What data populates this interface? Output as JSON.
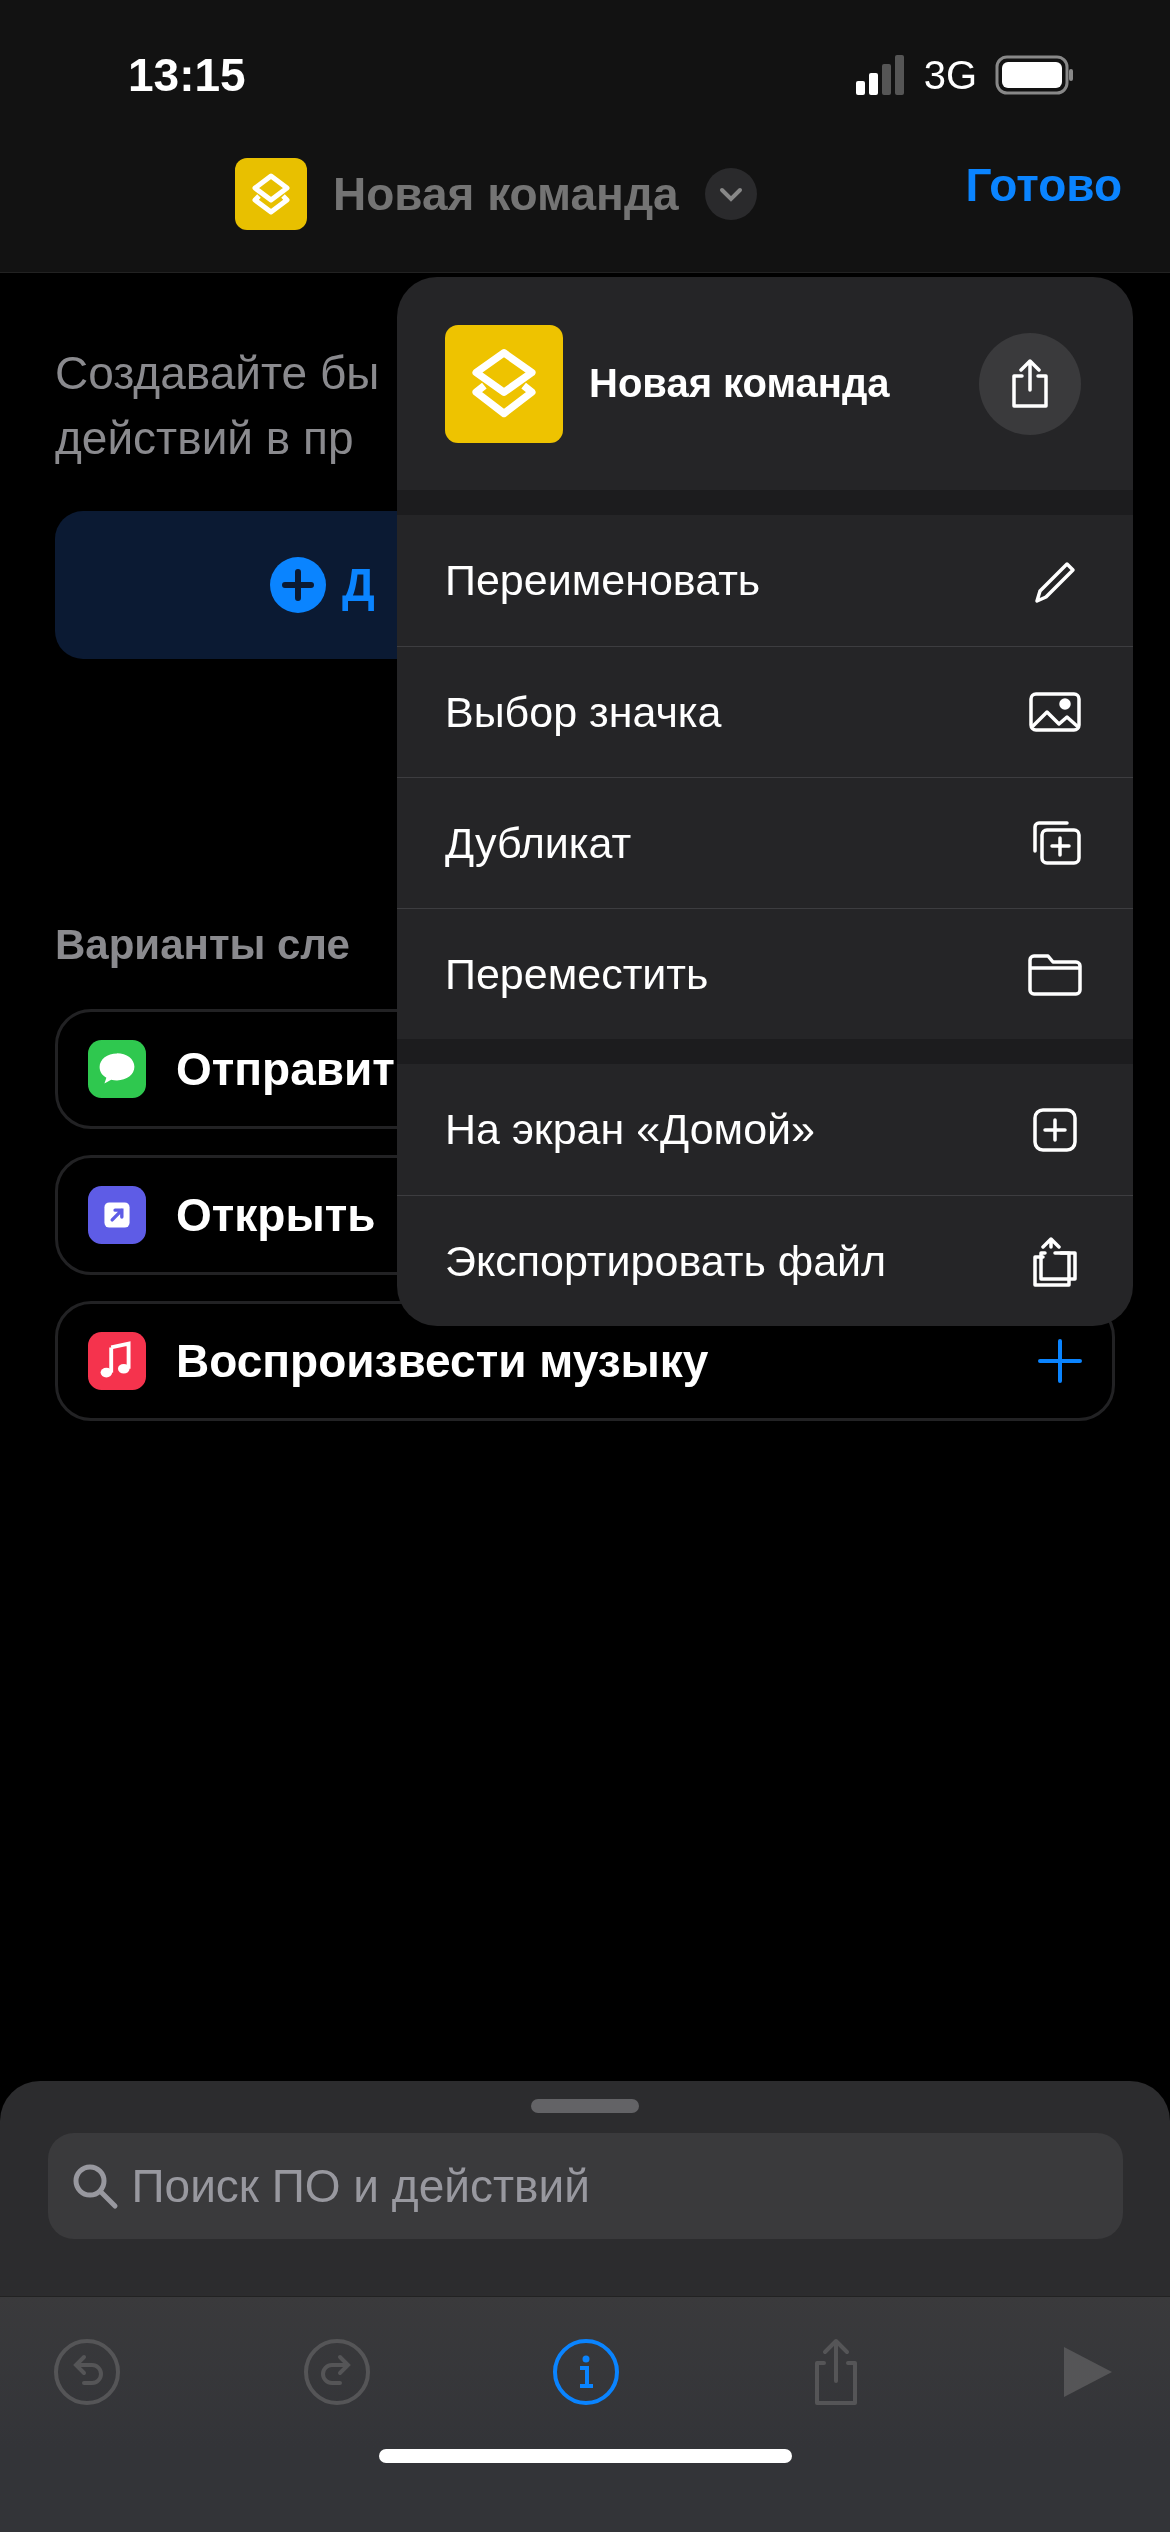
{
  "status_bar": {
    "time": "13:15",
    "network": "3G"
  },
  "nav": {
    "title": "Новая команда",
    "done": "Готово"
  },
  "content": {
    "description_lines": [
      "Создавайте бы",
      "действий в пр"
    ],
    "add_button": "Д",
    "suggestions_title": "Варианты сле",
    "suggestions": [
      {
        "label": "Отправит",
        "color": "#2fc84f",
        "add": false
      },
      {
        "label": "Открыть",
        "color": "#5e5ce6",
        "add": false
      },
      {
        "label": "Воспроизвести музыку",
        "color": "#f5334d",
        "add": true
      }
    ]
  },
  "menu": {
    "title": "Новая команда",
    "groups": [
      [
        {
          "label": "Переименовать"
        },
        {
          "label": "Выбор значка"
        },
        {
          "label": "Дубликат"
        },
        {
          "label": "Переместить"
        }
      ],
      [
        {
          "label": "На экран «Домой»"
        },
        {
          "label": "Экспортировать файл"
        }
      ]
    ]
  },
  "search": {
    "placeholder": "Поиск ПО и действий"
  },
  "toolbar": [
    {
      "selected": false
    },
    {
      "selected": false
    },
    {
      "selected": true
    },
    {
      "selected": false
    },
    {
      "selected": false
    }
  ]
}
